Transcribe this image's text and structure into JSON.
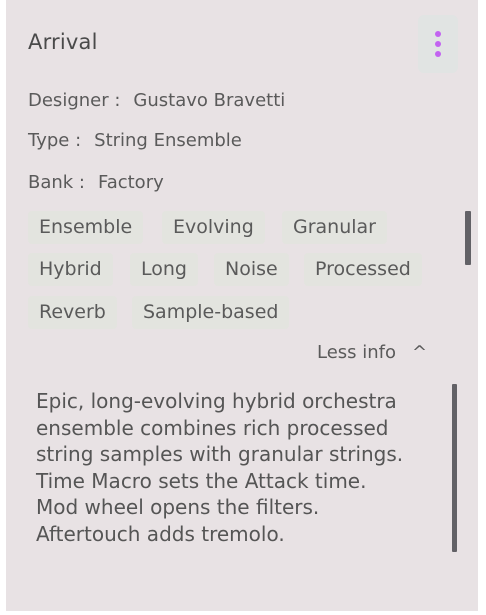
{
  "preset": {
    "name": "Arrival",
    "designer_label": "Designer :",
    "designer": "Gustavo Bravetti",
    "type_label": "Type :",
    "type": "String Ensemble",
    "bank_label": "Bank :",
    "bank": "Factory"
  },
  "tags": [
    "Ensemble",
    "Evolving",
    "Granular",
    "Hybrid",
    "Long",
    "Noise",
    "Processed",
    "Reverb",
    "Sample-based"
  ],
  "info_toggle": {
    "label": "Less info",
    "icon": "chevron-up-icon"
  },
  "description": "Epic, long-evolving hybrid orchestra\nensemble combines rich processed\nstring samples with granular strings.\nTime Macro sets the Attack time.\nMod wheel opens the filters.\nAftertouch adds tremolo.",
  "colors": {
    "panel_bg": "#e8e2e4",
    "tag_bg": "#e3e4df",
    "menu_dots": "#c264f0",
    "scrollbar": "#626166",
    "text": "#5a5a5a"
  },
  "icons": {
    "menu": "more-vertical-icon"
  }
}
